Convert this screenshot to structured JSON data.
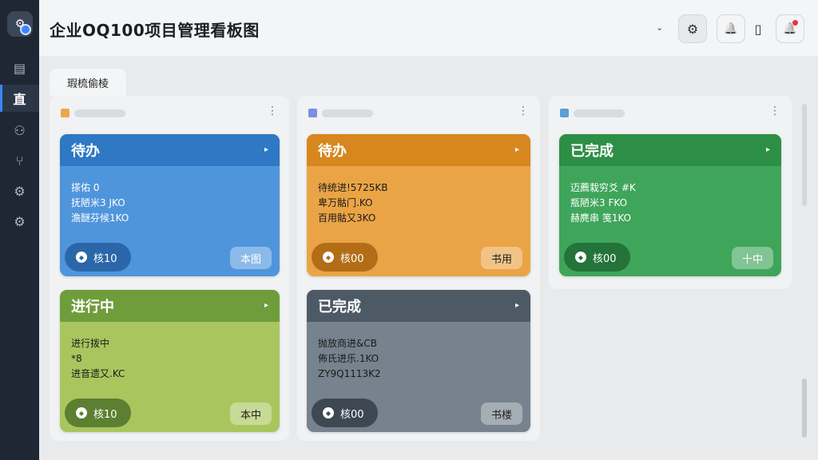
{
  "app": {
    "title": "企业OQ100项目管理看板图"
  },
  "sidebar": {
    "active_label": "直",
    "items": [
      {
        "icon": "document-icon",
        "glyph": "▤"
      },
      {
        "icon": "board-icon",
        "glyph": "直"
      },
      {
        "icon": "org-icon",
        "glyph": "⚇"
      },
      {
        "icon": "branch-icon",
        "glyph": "⑂"
      },
      {
        "icon": "settings-icon",
        "glyph": "⚙"
      },
      {
        "icon": "settings-alt-icon",
        "glyph": "⚙"
      }
    ]
  },
  "toolbar": {
    "chevron": "⌄",
    "settings_glyph": "⚙",
    "bell_glyph": "🔔",
    "mic_glyph": "▯",
    "alert_glyph": "🔔"
  },
  "tab": {
    "label": "瑕梳偷棱"
  },
  "columns": [
    {
      "accent": "#f0a64a",
      "name": "·····"
    },
    {
      "accent": "#7b8fe0",
      "name": "·····"
    },
    {
      "accent": "#5a9fd8",
      "name": "·····"
    }
  ],
  "cards": [
    {
      "title": "待办",
      "lines": [
        "搽佑 0",
        "抚陋米3 JKO",
        "澹醚芬候1KO"
      ],
      "badge": "核10",
      "tag": "本图",
      "head": "#2f78c4",
      "body": "#4f95dc",
      "pill": "#2b67a8",
      "text": "light"
    },
    {
      "title": "进行中",
      "lines": [
        "进行拨中",
        "*8",
        "进音遗又.KC"
      ],
      "badge": "核10",
      "tag": "本中",
      "head": "#6f9d3c",
      "body": "#a9c65e",
      "pill": "#5c7f32",
      "text": "dark"
    },
    {
      "title": "待办",
      "lines": [
        "待统进!5725KB",
        "卑万骷门.KO",
        "百用骷又3KO"
      ],
      "badge": "核00",
      "tag": "书用",
      "head": "#d6871e",
      "body": "#eaa446",
      "pill": "#b26d16",
      "text": "dark"
    },
    {
      "title": "已完成",
      "lines": [
        "抛放商进&CB",
        "佈氏进乐.1KO",
        "ZY9Q1113K2"
      ],
      "badge": "核00",
      "tag": "书楼",
      "head": "#4d5a66",
      "body": "#76838e",
      "pill": "#3d4853",
      "text": "dark"
    },
    {
      "title": "已完成",
      "lines": [
        "迈薦栽穷爻 #K",
        "瓶陋米3 FKO",
        "赫麂串 笺1KO"
      ],
      "badge": "核00",
      "tag": "十中",
      "head": "#2d8f45",
      "body": "#3fa55a",
      "pill": "#23733a",
      "text": "light"
    }
  ]
}
